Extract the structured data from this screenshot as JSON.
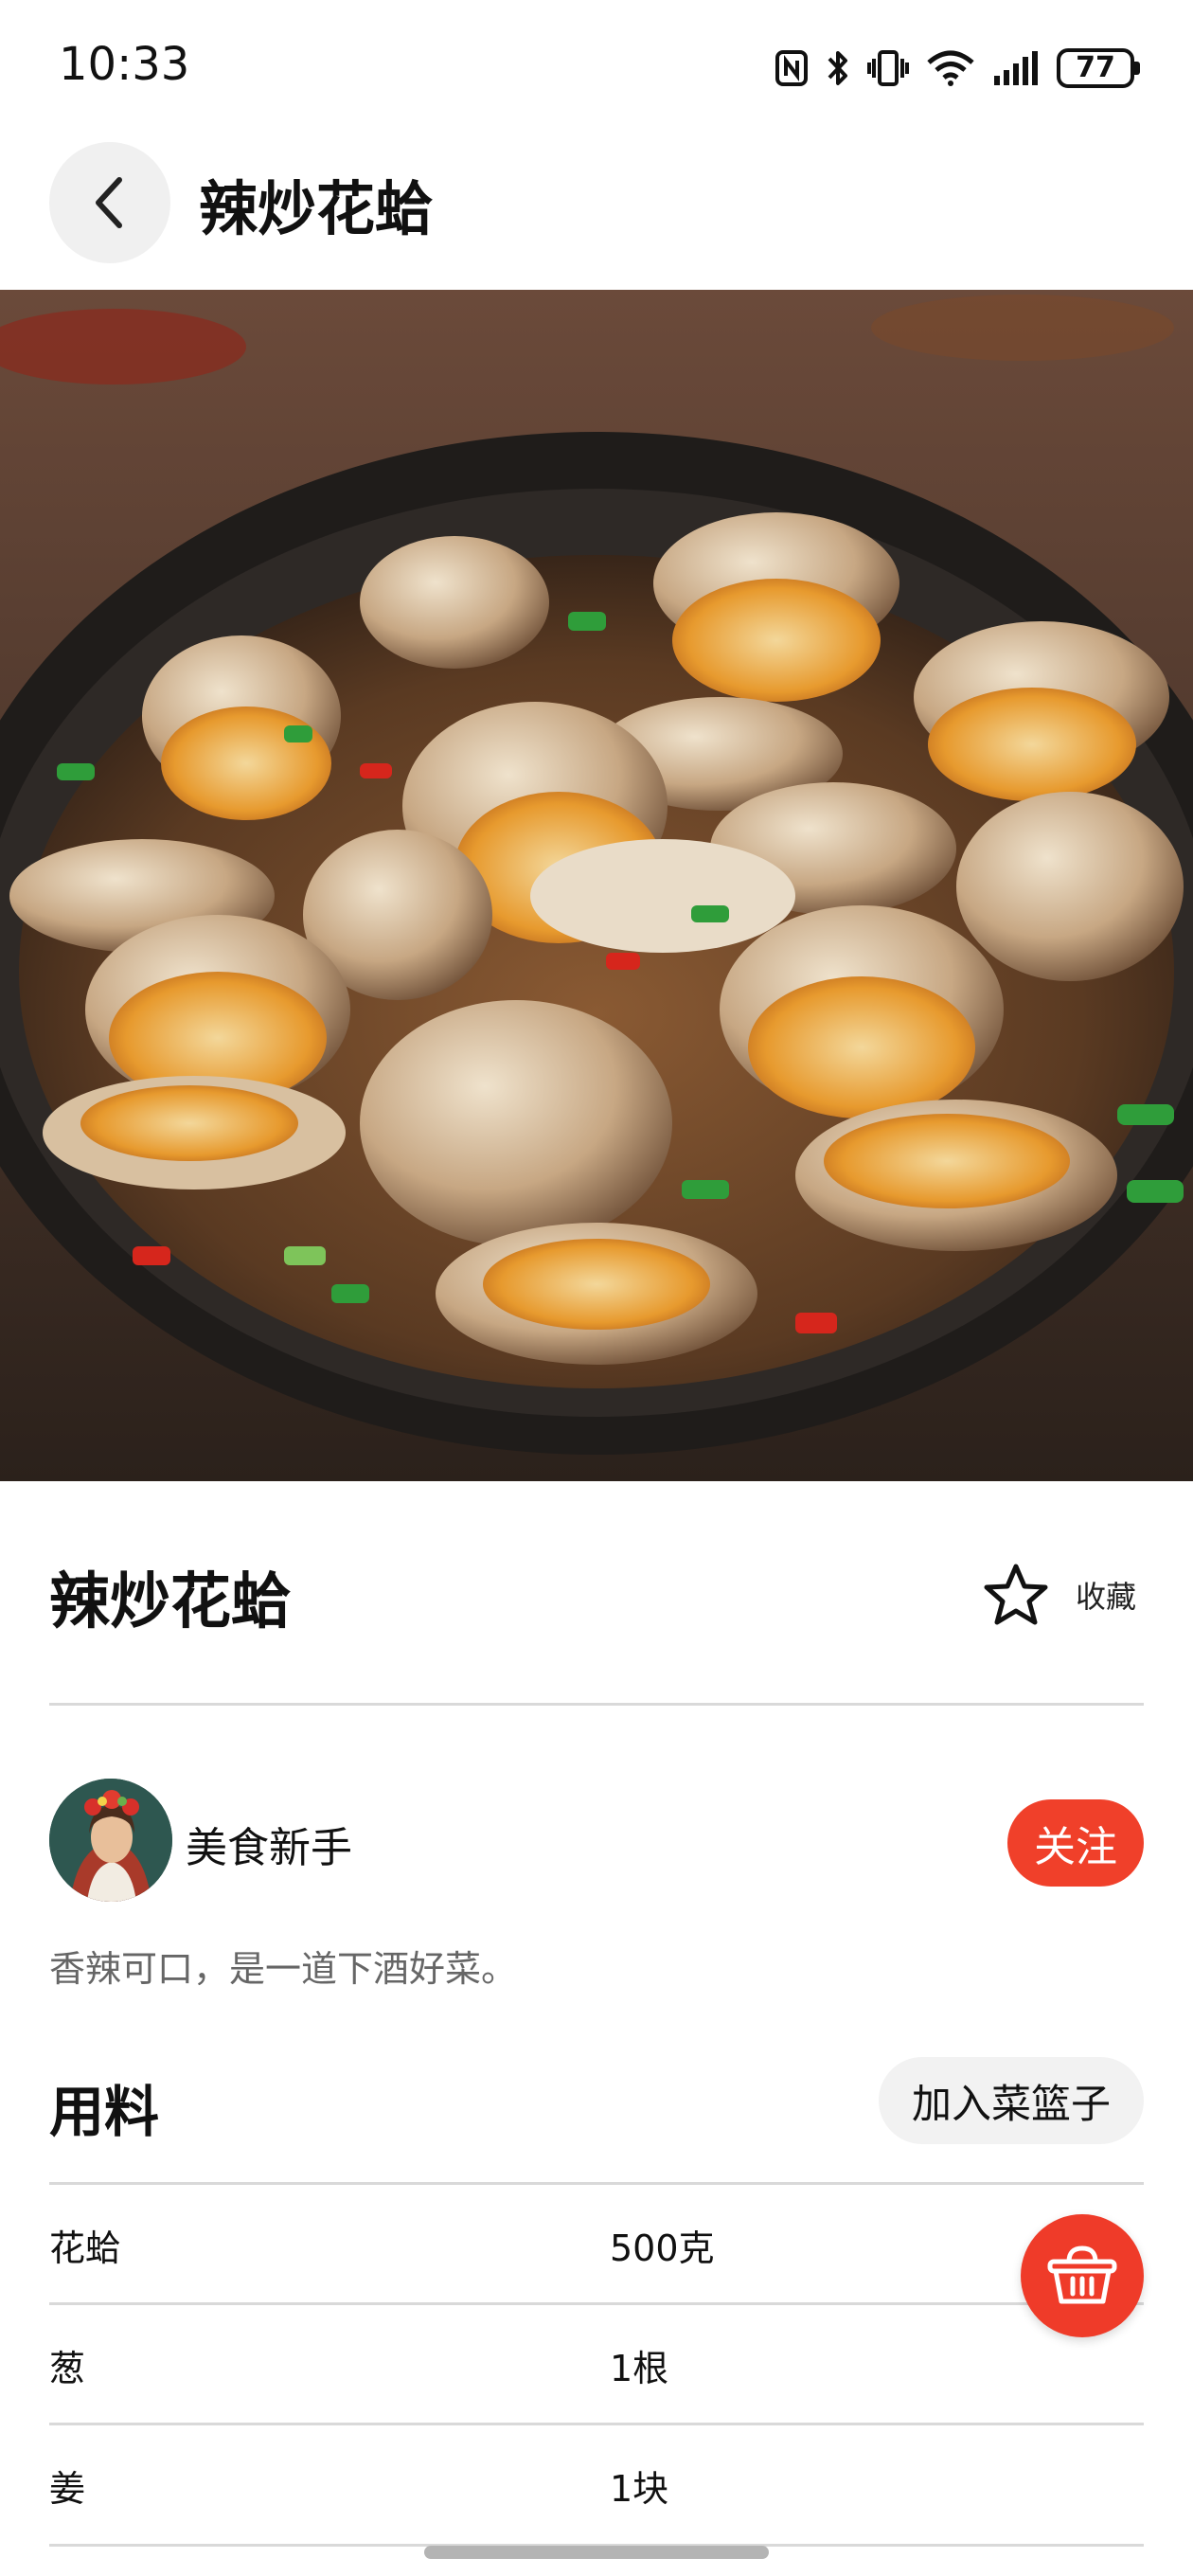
{
  "status_bar": {
    "time": "10:33",
    "battery": "77",
    "icons": [
      "nfc-icon",
      "bluetooth-icon",
      "vibrate-icon",
      "wifi-icon",
      "signal-icon",
      "battery-icon"
    ]
  },
  "header": {
    "title": "辣炒花蛤",
    "back_icon": "chevron-left-icon"
  },
  "hero_image": {
    "subject": "spicy stir-fried clams in pan"
  },
  "recipe": {
    "title": "辣炒花蛤",
    "favorite_label": "收藏",
    "favorite_icon": "star-outline-icon"
  },
  "author": {
    "name": "美食新手",
    "follow_label": "关注",
    "description": "香辣可口，是一道下酒好菜。"
  },
  "ingredients": {
    "section_title": "用料",
    "add_to_basket_label": "加入菜篮子",
    "items": [
      {
        "name": "花蛤",
        "qty": "500克"
      },
      {
        "name": "葱",
        "qty": "1根"
      },
      {
        "name": "姜",
        "qty": "1块"
      }
    ],
    "fab_icon": "basket-icon"
  },
  "colors": {
    "accent": "#f0402a",
    "chip_bg": "#f2f2f2",
    "divider": "#d9d9d9",
    "muted_text": "#666666"
  }
}
